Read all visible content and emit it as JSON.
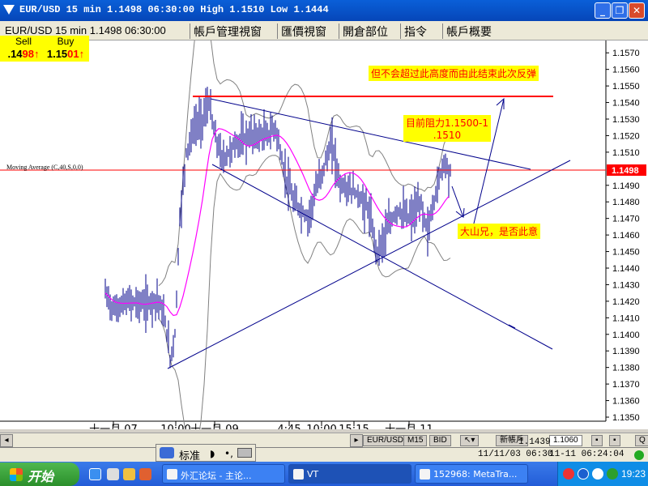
{
  "window": {
    "title": "EUR/USD 15 min 1.1498 06:30:00 High 1.1510 Low 1.1444",
    "minimize_icon": "minimize-icon",
    "restore_icon": "restore-icon",
    "close_icon": "close-icon"
  },
  "toolbar": {
    "symbol_title": "EUR/USD 15 min 1.1498 06:30:00",
    "tabs": [
      "帳戶管理視窗",
      "匯價視窗",
      "開倉部位",
      "指令",
      "帳戶概要"
    ]
  },
  "quote": {
    "sell_label": "Sell",
    "sell_price_prefix": ".14",
    "sell_price_big": "98",
    "buy_label": "Buy",
    "buy_price_prefix": "1.15",
    "buy_price_big": "01",
    "arrow": "↑"
  },
  "chart": {
    "indicator_label": "Moving Average (C,40,S,0,0)",
    "current_price": "1.1498",
    "price_axis": [
      "1.1570",
      "1.1560",
      "1.1550",
      "1.1540",
      "1.1530",
      "1.1520",
      "1.1510",
      "1.1490",
      "1.1480",
      "1.1470",
      "1.1460",
      "1.1450",
      "1.1440",
      "1.1430",
      "1.1420",
      "1.1410",
      "1.1400",
      "1.1390",
      "1.1380",
      "1.1370",
      "1.1360",
      "1.1350"
    ],
    "time_axis": [
      "十一月.07",
      "10:00",
      "十一月.09",
      "4:45",
      "10:00",
      "15:15",
      "十一月.11"
    ],
    "annotations": {
      "top": "但不会超过此高度而由此结束此次反弹",
      "resistance_line1": "目前阻力1.1500-1",
      "resistance_line2": ".1510",
      "bottom": "大山兄，是否此意"
    },
    "colors": {
      "candles": "#00008b",
      "moving_average": "#ff00ff",
      "bands": "#808080",
      "trendlines": "#00008b",
      "horizontal_lines": "#ff0000"
    }
  },
  "chart_data": {
    "type": "line",
    "title": "EUR/USD 15 min",
    "xlabel": "",
    "ylabel": "",
    "ylim": [
      1.135,
      1.1575
    ],
    "x": [
      "十一月.07",
      "10:00",
      "十一月.09",
      "4:45",
      "10:00",
      "15:15",
      "十一月.11"
    ],
    "series": [
      {
        "name": "EUR/USD",
        "values": [
          1.142,
          1.138,
          1.154,
          1.151,
          1.147,
          1.145,
          1.15
        ]
      },
      {
        "name": "Moving Average (C,40,S,0,0)",
        "values": [
          1.142,
          1.1415,
          1.148,
          1.1505,
          1.1495,
          1.1475,
          1.148
        ]
      }
    ]
  },
  "bottom_bar": {
    "symbol_tab": "EUR/USD",
    "period_tab": "M15",
    "side_tab": "BID",
    "account_tab": "新帳戶",
    "price_box": "1.1060",
    "left_arrow": "◂",
    "right_arrow": "▸",
    "q_label": "Q"
  },
  "status": {
    "datetime": "11/11/03 06:30",
    "price": "1.1439",
    "server_time": "11-11 06:24:04"
  },
  "ime": {
    "mode": "标准"
  },
  "taskbar": {
    "start_label": "开始",
    "tasks": [
      "外汇论坛 - 主论...",
      "VT",
      "152968: MetaTra..."
    ],
    "clock": "19:23"
  }
}
